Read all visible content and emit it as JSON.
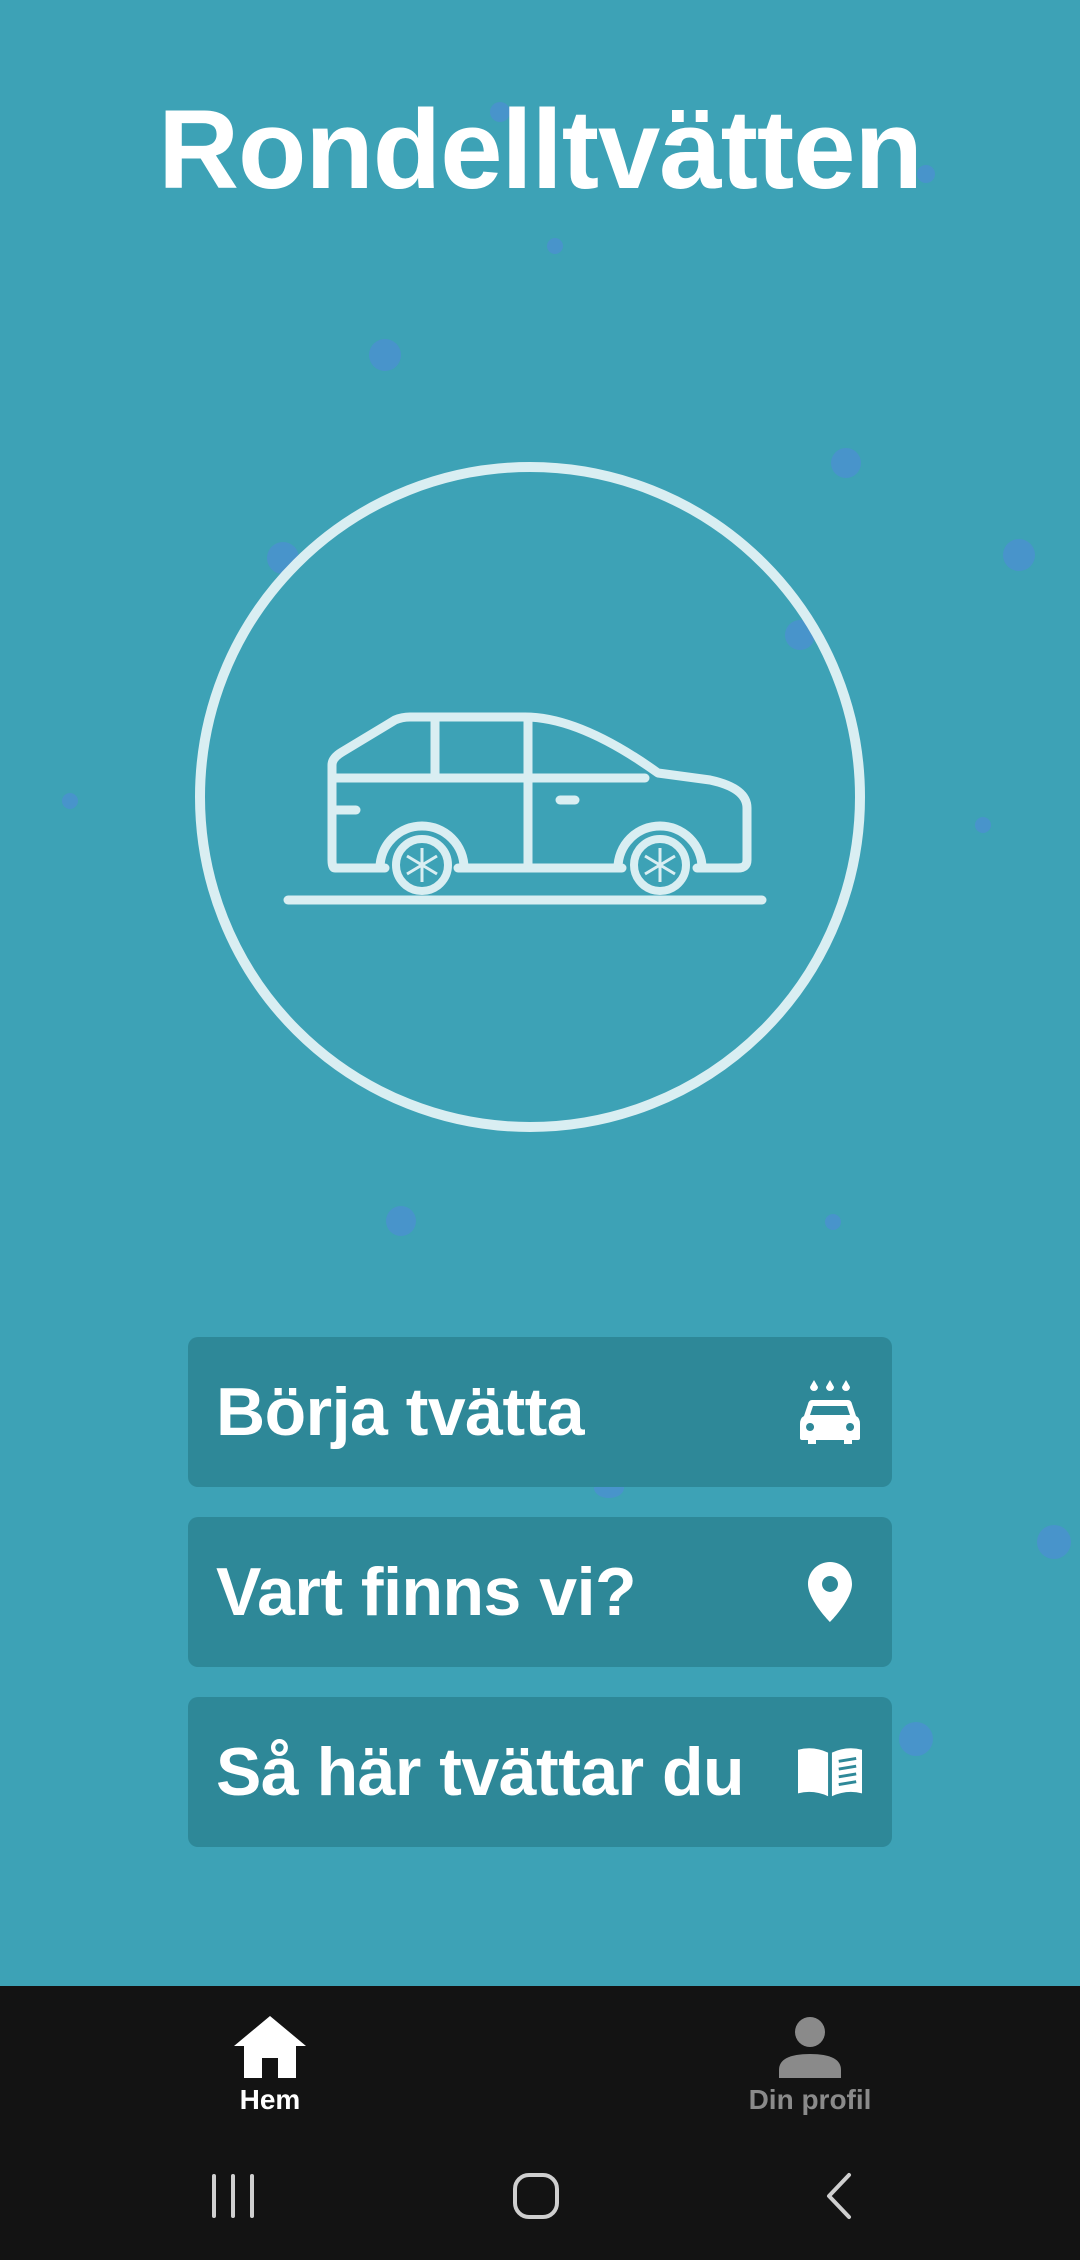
{
  "app": {
    "title": "Rondelltvätten"
  },
  "colors": {
    "background": "#3da2b6",
    "button": "#2e8898",
    "circle": "#d9eef2",
    "nav_background": "#131313",
    "nav_active": "#ffffff",
    "nav_inactive": "#8a8a8a"
  },
  "logo": {
    "icon": "car-icon"
  },
  "menu": {
    "items": [
      {
        "label": "Börja tvätta",
        "icon": "car-wash-icon"
      },
      {
        "label": "Vart finns vi?",
        "icon": "location-pin-icon"
      },
      {
        "label": "Så här tvättar du",
        "icon": "book-icon"
      }
    ]
  },
  "bottom_nav": {
    "items": [
      {
        "label": "Hem",
        "icon": "home-icon",
        "active": true
      },
      {
        "label": "Din profil",
        "icon": "person-icon",
        "active": false
      }
    ]
  },
  "system_nav": {
    "items": [
      {
        "icon": "recent-apps-icon"
      },
      {
        "icon": "home-circle-icon"
      },
      {
        "icon": "back-icon"
      }
    ]
  }
}
